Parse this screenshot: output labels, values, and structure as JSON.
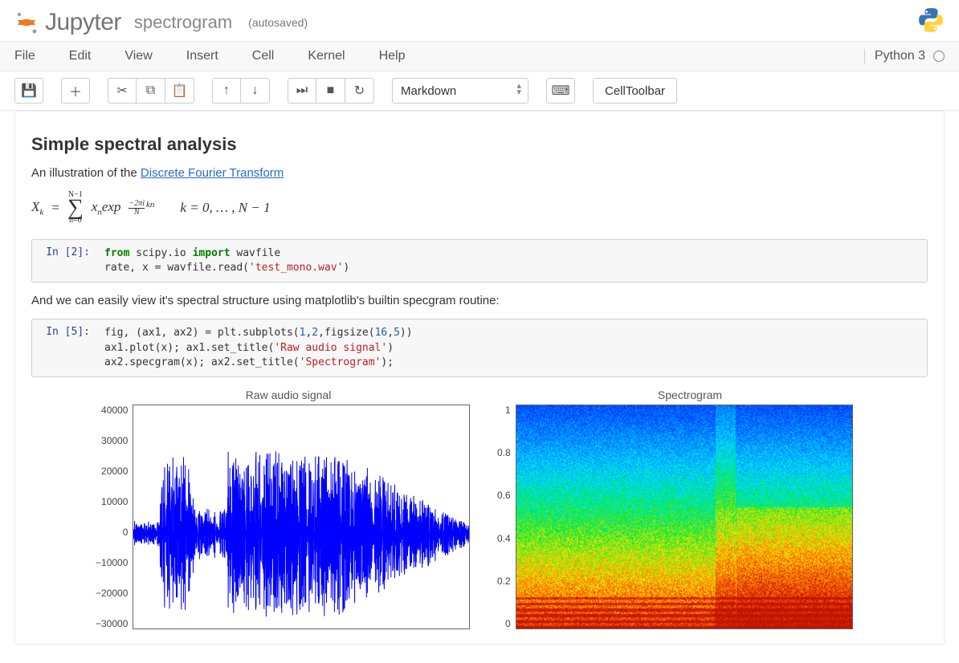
{
  "header": {
    "logo_word": "Jupyter",
    "title": "spectrogram",
    "autosaved": "(autosaved)"
  },
  "kernel": {
    "name": "Python 3"
  },
  "menu": {
    "items": [
      "File",
      "Edit",
      "View",
      "Insert",
      "Cell",
      "Kernel",
      "Help"
    ]
  },
  "toolbar": {
    "celltype_selected": "Markdown",
    "celltoolbar_label": "CellToolbar"
  },
  "notebook": {
    "heading": "Simple spectral analysis",
    "md1_prefix": "An illustration of the ",
    "md1_link": "Discrete Fourier Transform",
    "math": {
      "lhs_var": "X",
      "lhs_sub": "k",
      "eq": "=",
      "sum_top": "N−1",
      "sum_bot": "n=0",
      "term": "x",
      "term_sub": "n",
      "exp_word": "exp",
      "frac_top": "−2πi",
      "frac_bot": "N",
      "exp_tail": "kn",
      "range": "k = 0, … , N − 1"
    },
    "cell2": {
      "prompt": "In [2]:",
      "line1": {
        "kw1": "from",
        "mod": " scipy.io ",
        "kw2": "import",
        "tail": " wavfile"
      },
      "line2": {
        "pre": "rate, x = wavfile.read(",
        "str": "'test_mono.wav'",
        "post": ")"
      }
    },
    "md2": "And we can easily view it's spectral structure using matplotlib's builtin specgram routine:",
    "cell5": {
      "prompt": "In [5]:",
      "line1": {
        "pre": "fig, (ax1, ax2) = plt.subplots(",
        "n1": "1",
        "c1": ",",
        "n2": "2",
        "c2": ",figsize(",
        "n3": "16",
        "c3": ",",
        "n4": "5",
        "post": "))"
      },
      "line2": {
        "pre": "ax1.plot(x); ax1.set_title(",
        "str": "'Raw audio signal'",
        "post": ")"
      },
      "line3": {
        "pre": "ax2.specgram(x); ax2.set_title(",
        "str": "'Spectrogram'",
        "post": ");"
      }
    }
  },
  "chart_data": [
    {
      "type": "line",
      "title": "Raw audio signal",
      "xlabel": "",
      "ylabel": "",
      "ylim": [
        -30000,
        40000
      ],
      "yticks": [
        40000,
        30000,
        20000,
        10000,
        0,
        -10000,
        -20000,
        -30000
      ],
      "note": "Dense audio waveform; amplitude oscillates roughly between -25000 and 30000 across the time axis."
    },
    {
      "type": "heatmap",
      "title": "Spectrogram",
      "xlabel": "",
      "ylabel": "",
      "ylim": [
        0.0,
        1.0
      ],
      "yticks": [
        1.0,
        0.8,
        0.6,
        0.4,
        0.2,
        0.0
      ],
      "note": "Time-frequency spectrogram; higher intensity (red/yellow) concentrated below ~0.4, cyan/blue above."
    }
  ]
}
